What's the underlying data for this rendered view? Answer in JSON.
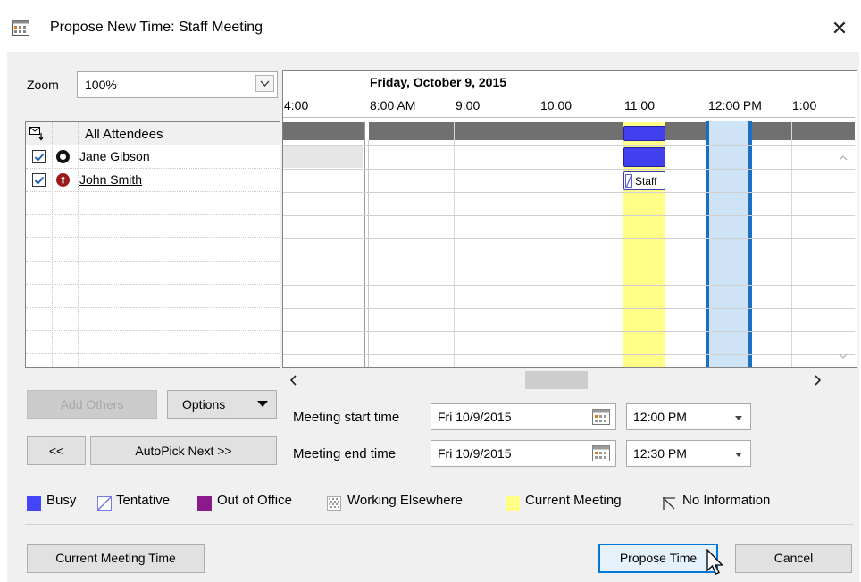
{
  "window": {
    "title": "Propose New Time:  Staff Meeting",
    "close_glyph": "✕"
  },
  "zoom": {
    "label": "Zoom",
    "value": "100%"
  },
  "attendees": {
    "header": "All Attendees",
    "items": [
      {
        "name": "Jane Gibson",
        "checked": true,
        "icon": "organizer-icon"
      },
      {
        "name": "John Smith",
        "checked": true,
        "icon": "required-attendee-icon"
      }
    ]
  },
  "timeline": {
    "date": "Friday, October 9, 2015",
    "times": [
      "4:00",
      "8:00 AM",
      "9:00",
      "10:00",
      "11:00",
      "12:00 PM",
      "1:00"
    ],
    "appointment_label": "Staff"
  },
  "buttons": {
    "add_others": "Add Others",
    "options": "Options",
    "prev": "<<",
    "autopick_next": "AutoPick Next >>",
    "current_meeting_time": "Current Meeting Time",
    "propose_time": "Propose Time",
    "cancel": "Cancel"
  },
  "meeting": {
    "start_label": "Meeting start time",
    "start_date": "Fri 10/9/2015",
    "start_time": "12:00 PM",
    "end_label": "Meeting end time",
    "end_date": "Fri 10/9/2015",
    "end_time": "12:30 PM"
  },
  "legend": [
    {
      "label": "Busy",
      "color": "#4444f8"
    },
    {
      "label": "Tentative",
      "color": "#7777ee"
    },
    {
      "label": "Out of Office",
      "color": "#8b1a8b"
    },
    {
      "label": "Working Elsewhere",
      "color": "#aaaaaa"
    },
    {
      "label": "Current Meeting",
      "color": "#ffff88"
    },
    {
      "label": "No Information",
      "color": "#333333"
    }
  ],
  "colors": {
    "busy": "#4040f0",
    "current_meeting": "#ffff88",
    "proposed": "#cfe3f7",
    "proposed_border": "#1a6fc4",
    "header_bar": "#707070"
  }
}
